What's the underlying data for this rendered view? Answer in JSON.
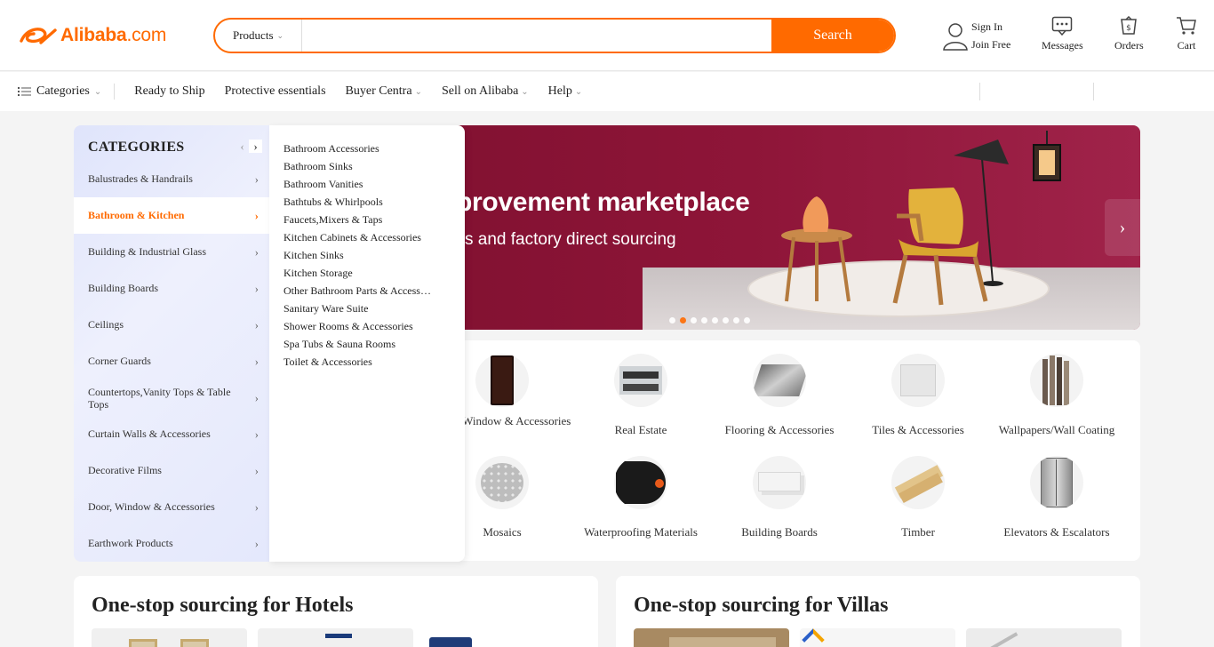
{
  "header": {
    "logo_text": "Alibaba",
    "logo_suffix": ".com",
    "search": {
      "category": "Products",
      "placeholder": "",
      "button": "Search"
    },
    "sign_in": "Sign In",
    "join": "Join Free",
    "messages": "Messages",
    "orders": "Orders",
    "cart": "Cart"
  },
  "nav": {
    "categories": "Categories",
    "items": [
      {
        "label": "Ready to Ship"
      },
      {
        "label": "Protective essentials"
      },
      {
        "label": "Buyer Centra"
      },
      {
        "label": "Sell on Alibaba"
      },
      {
        "label": "Help"
      }
    ]
  },
  "categories": {
    "title": "CATEGORIES",
    "items": [
      "Balustrades & Handrails",
      "Bathroom & Kitchen",
      "Building & Industrial Glass",
      "Building Boards",
      "Ceilings",
      "Corner Guards",
      "Countertops,Vanity Tops & Table Tops",
      "Curtain Walls & Accessories",
      "Decorative Films",
      "Door, Window & Accessories",
      "Earthwork Products"
    ],
    "active": "Bathroom & Kitchen"
  },
  "subcategories": [
    "Bathroom Accessories",
    "Bathroom Sinks",
    "Bathroom Vanities",
    "Bathtubs & Whirlpools",
    "Faucets,Mixers & Taps",
    "Kitchen Cabinets & Accessories",
    "Kitchen Sinks",
    "Kitchen Storage",
    "Other Bathroom Parts & Accessories",
    "Sanitary Ware Suite",
    "Shower Rooms & Accessories",
    "Spa Tubs & Sauna Rooms",
    "Toilet & Accessories"
  ],
  "banner": {
    "title": "provement marketplace",
    "subtitle": "s and factory direct sourcing",
    "slide_count": 8,
    "active_slide": 2
  },
  "grid": {
    "row1": [
      "Door, Window & Accessories",
      "Real Estate",
      "Flooring & Accessories",
      "Tiles & Accessories",
      "Wallpapers/Wall Coating"
    ],
    "row2": [
      "Mosaics",
      "Waterproofing Materials",
      "Building Boards",
      "Timber",
      "Elevators & Escalators"
    ]
  },
  "sourcing": {
    "hotels": "One-stop sourcing for Hotels",
    "villas": "One-stop sourcing for Villas"
  },
  "colors": {
    "accent": "#ff6a00",
    "banner": "#8e1538"
  }
}
